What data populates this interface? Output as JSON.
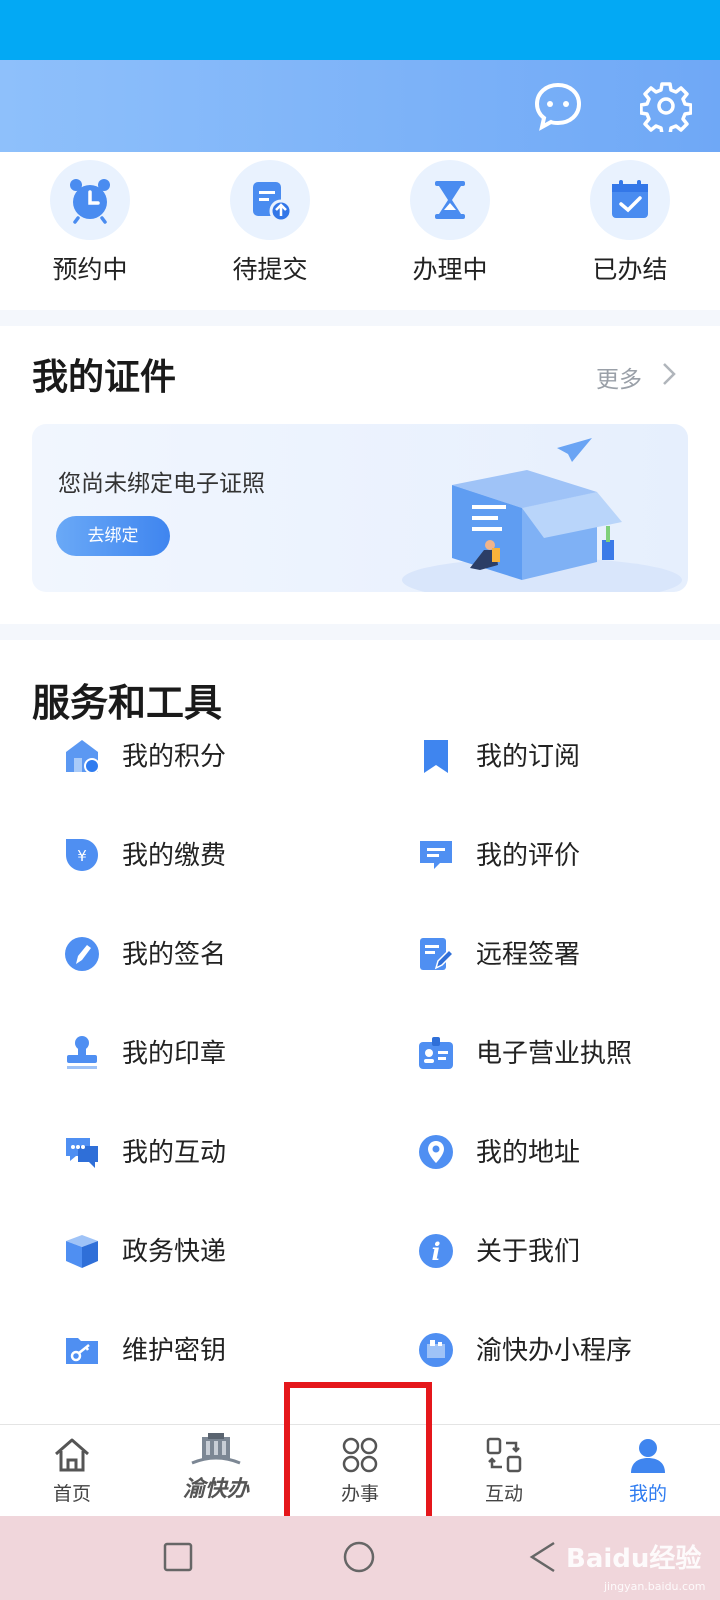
{
  "header": {
    "chat_icon": "chat-bubble-icon",
    "settings_icon": "gear-icon"
  },
  "status": [
    {
      "label": "预约中",
      "icon": "alarm-clock-icon"
    },
    {
      "label": "待提交",
      "icon": "document-upload-icon"
    },
    {
      "label": "办理中",
      "icon": "hourglass-icon"
    },
    {
      "label": "已办结",
      "icon": "calendar-check-icon"
    }
  ],
  "certificates": {
    "title": "我的证件",
    "more": "更多",
    "empty_message": "您尚未绑定电子证照",
    "bind_button": "去绑定"
  },
  "tools": {
    "title": "服务和工具",
    "items": [
      {
        "label": "我的积分",
        "icon": "points-store-icon"
      },
      {
        "label": "我的订阅",
        "icon": "bookmark-icon"
      },
      {
        "label": "我的缴费",
        "icon": "yuan-payment-icon"
      },
      {
        "label": "我的评价",
        "icon": "comment-icon"
      },
      {
        "label": "我的签名",
        "icon": "pen-icon"
      },
      {
        "label": "远程签署",
        "icon": "sign-document-icon"
      },
      {
        "label": "我的印章",
        "icon": "stamp-icon"
      },
      {
        "label": "电子营业执照",
        "icon": "license-badge-icon"
      },
      {
        "label": "我的互动",
        "icon": "chat-bubbles-icon"
      },
      {
        "label": "我的地址",
        "icon": "location-pin-icon"
      },
      {
        "label": "政务快递",
        "icon": "package-icon"
      },
      {
        "label": "关于我们",
        "icon": "info-icon"
      },
      {
        "label": "维护密钥",
        "icon": "key-folder-icon"
      },
      {
        "label": "渝快办小程序",
        "icon": "mini-program-icon"
      }
    ]
  },
  "nav": {
    "home": "首页",
    "logo": "渝快办",
    "services": "办事",
    "interact": "互动",
    "mine": "我的",
    "active": "我的"
  },
  "watermark": {
    "text": "Baidu经验",
    "sub": "jingyan.baidu.com"
  },
  "colors": {
    "accent": "#2f7cf0",
    "highlight": "#e5171b",
    "status_bar": "#03a9f4"
  }
}
